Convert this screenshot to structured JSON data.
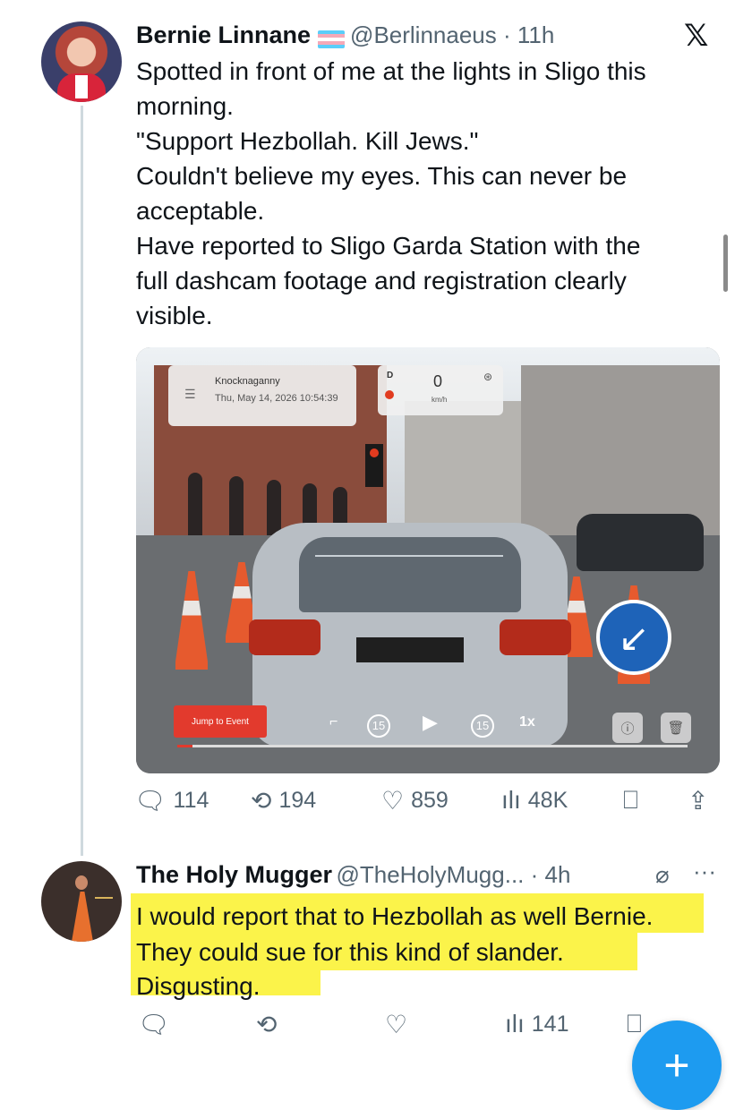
{
  "tweet": {
    "author_name": "Bernie Linnane",
    "handle": "@Berlinnaeus",
    "time": "11h",
    "text": "Spotted in front of me at the lights in Sligo this\nmorning.\n\"Support Hezbollah. Kill Jews.\"\nCouldn't believe my eyes. This can never be\nacceptable.\nHave reported to Sligo Garda Station with the\nfull dashcam footage and registration clearly\nvisible.",
    "media": {
      "location": "Knocknaganny",
      "datetime": "Thu, May 14, 2026 10:54:39",
      "speed_indicator": "D",
      "speed_value": "0",
      "speed_unit": "km/h",
      "jump_button": "Jump to Event",
      "rewind": "15",
      "forward": "15",
      "playback_speed": "1x",
      "progress": 0.03
    },
    "stats": {
      "replies": "114",
      "reposts": "194",
      "likes": "859",
      "views": "48K"
    }
  },
  "reply": {
    "author_name": "The Holy Mugger",
    "handle": "@TheHolyMugg...",
    "time": "4h",
    "lines": [
      "I would report that to Hezbollah as well Bernie.",
      "They could sue for this kind of slander.",
      "Disgusting."
    ],
    "highlight_color": "#fbf34a",
    "stats": {
      "views": "141"
    }
  },
  "colors": {
    "accent": "#1d9bf0",
    "muted": "#536471"
  }
}
